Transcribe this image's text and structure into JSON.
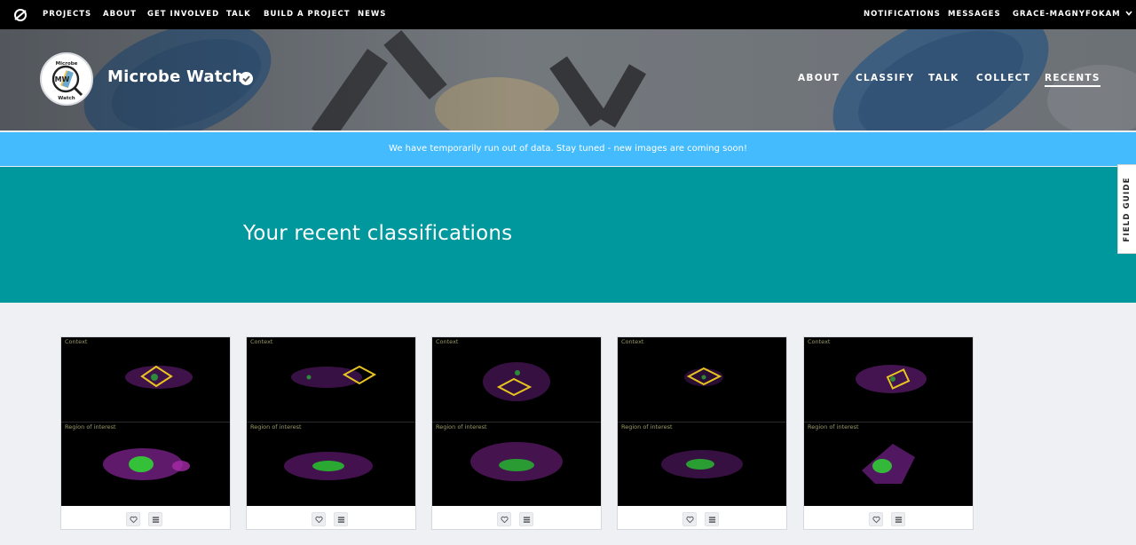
{
  "topnav": {
    "logo_icon": "zooniverse-logo-icon",
    "items": [
      "PROJECTS",
      "ABOUT",
      "GET INVOLVED",
      "TALK",
      "BUILD A PROJECT",
      "NEWS"
    ],
    "right": {
      "notifications": "NOTIFICATIONS",
      "messages": "MESSAGES",
      "user": "GRACE-MAGNYFOKAM",
      "user_icon": "chevron-down-icon"
    }
  },
  "project": {
    "title": "Microbe Watch",
    "verified_icon": "verified-check-icon",
    "avatar": {
      "top_text": "Microbe",
      "center_text": "MW",
      "bottom_text": "Watch"
    },
    "nav": [
      "ABOUT",
      "CLASSIFY",
      "TALK",
      "COLLECT",
      "RECENTS"
    ],
    "active_nav": "RECENTS"
  },
  "banner": {
    "text": "We have temporarily run out of data. Stay tuned - new images are coming soon!",
    "color": "#43bbfd"
  },
  "section": {
    "title": "Your recent classifications",
    "background": "#00979d"
  },
  "field_guide": {
    "label": "FIELD GUIDE"
  },
  "recents": [
    {
      "context_label": "Context",
      "roi_label": "Region of interest",
      "favorite_icon": "heart-icon",
      "collect_icon": "list-icon"
    },
    {
      "context_label": "Context",
      "roi_label": "Region of interest",
      "favorite_icon": "heart-icon",
      "collect_icon": "list-icon"
    },
    {
      "context_label": "Context",
      "roi_label": "Region of interest",
      "favorite_icon": "heart-icon",
      "collect_icon": "list-icon"
    },
    {
      "context_label": "Context",
      "roi_label": "Region of interest",
      "favorite_icon": "heart-icon",
      "collect_icon": "list-icon"
    },
    {
      "context_label": "Context",
      "roi_label": "Region of interest",
      "favorite_icon": "heart-icon",
      "collect_icon": "list-icon"
    }
  ]
}
